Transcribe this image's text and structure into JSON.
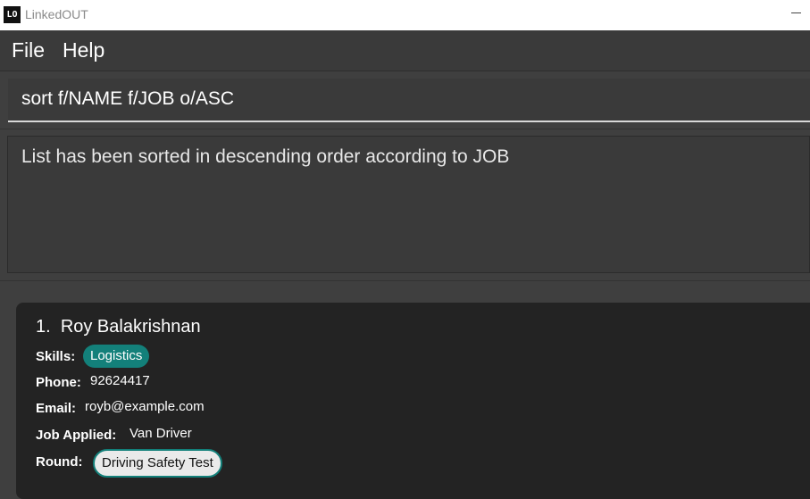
{
  "window": {
    "logo_text": "LO",
    "title": "LinkedOUT",
    "minimize_icon": "minimize-icon"
  },
  "menu": {
    "file": "File",
    "help": "Help"
  },
  "command": {
    "value": "sort f/NAME f/JOB o/ASC"
  },
  "result": {
    "message": "List has been sorted in descending order according to JOB"
  },
  "colors": {
    "accent": "#13807a",
    "background": "#3f3f3f",
    "card": "#232323"
  },
  "applicants": [
    {
      "index": "1.",
      "name": "Roy Balakrishnan",
      "skills_label": "Skills:",
      "skills": [
        "Logistics"
      ],
      "phone_label": "Phone:",
      "phone": "92624417",
      "email_label": "Email:",
      "email": "royb@example.com",
      "job_label": "Job Applied:",
      "job": "Van Driver",
      "round_label": "Round:",
      "round": "Driving Safety Test"
    }
  ]
}
